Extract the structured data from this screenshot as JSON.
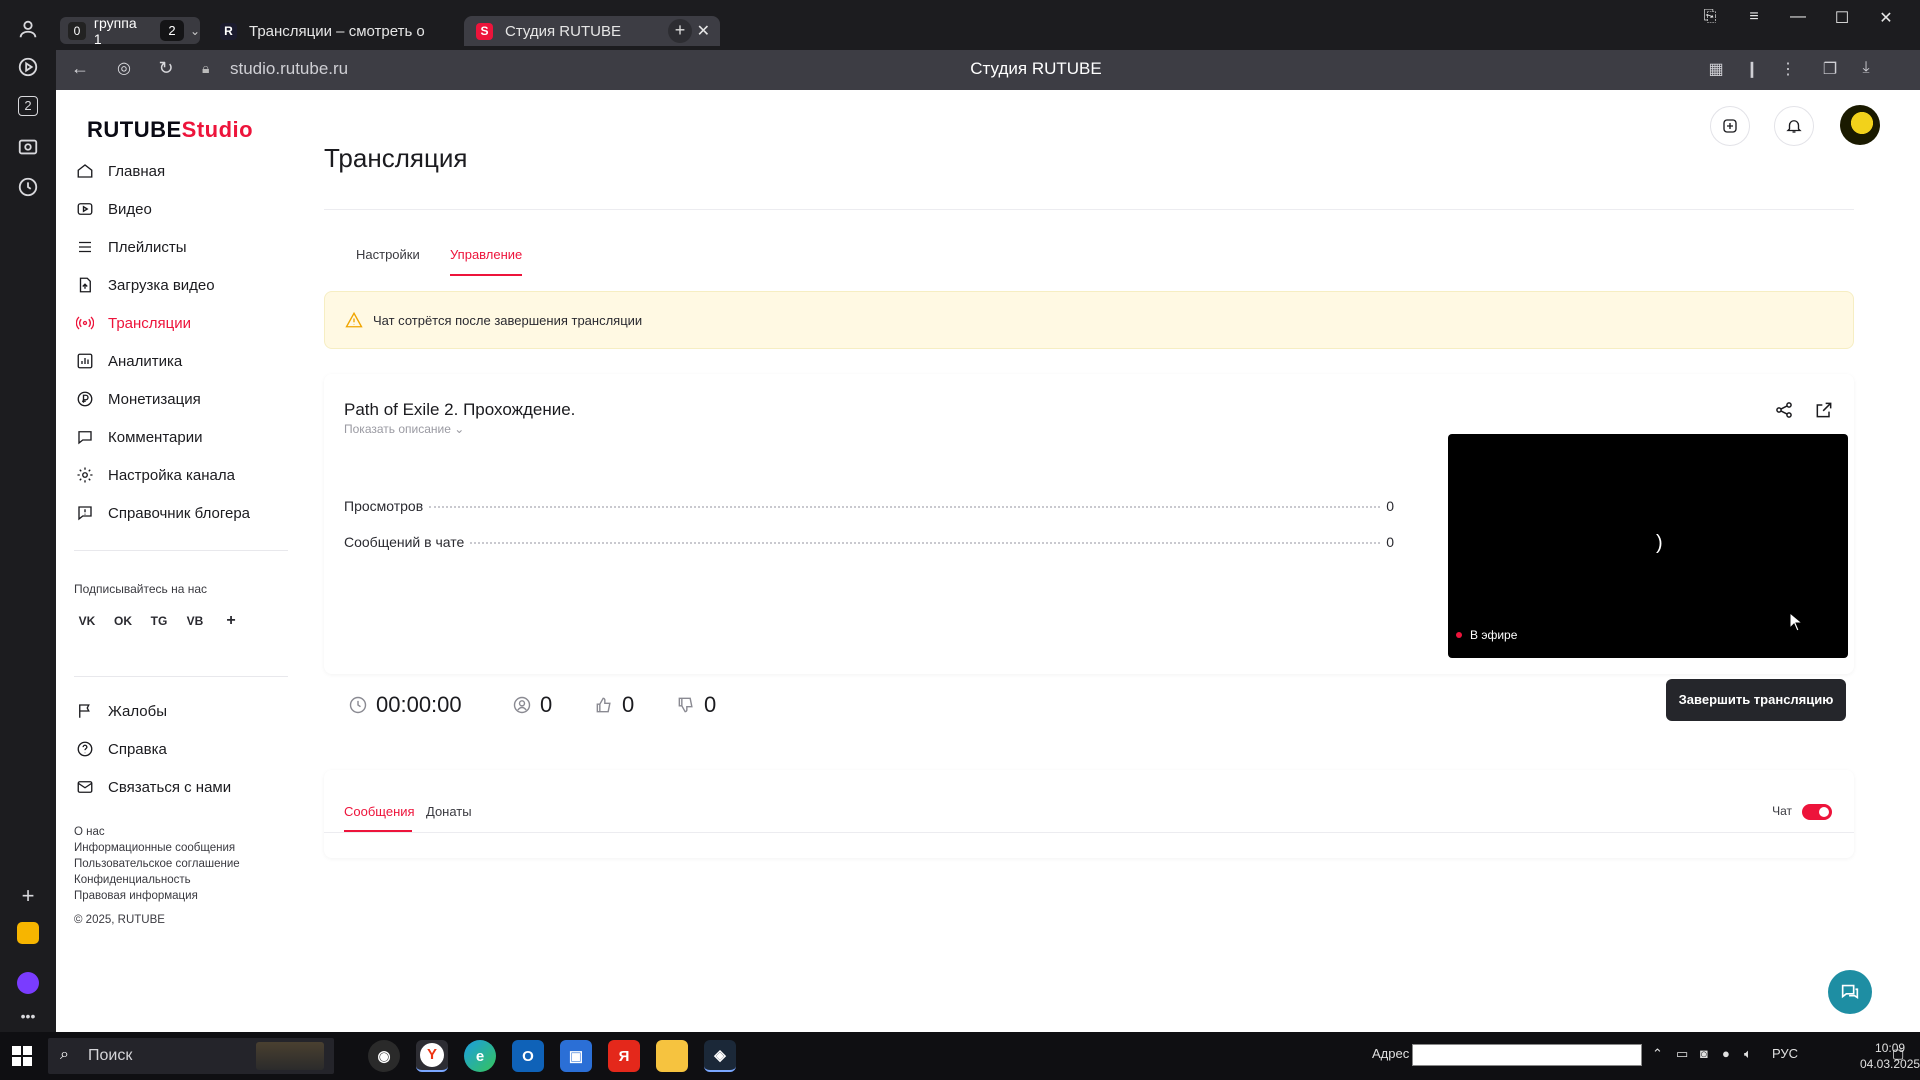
{
  "browser": {
    "group": {
      "count": "0",
      "name": "группа 1",
      "badge": "2"
    },
    "tabs": [
      {
        "label": "Трансляции – смотреть о",
        "favicon": "R"
      },
      {
        "label": "Студия RUTUBE",
        "favicon": "S"
      }
    ],
    "url": "studio.rutube.ru",
    "page_title": "Студия RUTUBE",
    "rail_badge": "2"
  },
  "logo": {
    "brand": "RUTUBE",
    "suffix": "Studio"
  },
  "sidebar": {
    "items": [
      {
        "label": "Главная",
        "icon": "home-icon"
      },
      {
        "label": "Видео",
        "icon": "video-icon"
      },
      {
        "label": "Плейлисты",
        "icon": "playlist-icon"
      },
      {
        "label": "Загрузка видео",
        "icon": "upload-icon"
      },
      {
        "label": "Трансляции",
        "icon": "broadcast-icon",
        "active": true
      },
      {
        "label": "Аналитика",
        "icon": "analytics-icon"
      },
      {
        "label": "Монетизация",
        "icon": "ruble-icon"
      },
      {
        "label": "Комментарии",
        "icon": "comments-icon"
      },
      {
        "label": "Настройка канала",
        "icon": "gear-icon"
      },
      {
        "label": "Справочник блогера",
        "icon": "book-icon"
      }
    ],
    "follow_title": "Подписывайтесь на нас",
    "socials": [
      "VK",
      "OK",
      "TG",
      "VB",
      "+"
    ],
    "secondary": [
      {
        "label": "Жалобы",
        "icon": "flag-icon"
      },
      {
        "label": "Справка",
        "icon": "help-icon"
      },
      {
        "label": "Связаться с нами",
        "icon": "mail-icon"
      }
    ],
    "footer_links": [
      "О нас",
      "Информационные сообщения",
      "Пользовательское соглашение",
      "Конфиденциальность",
      "Правовая информация"
    ],
    "copyright": "© 2025, RUTUBE"
  },
  "main": {
    "title": "Трансляция",
    "tabs": [
      "Настройки",
      "Управление"
    ],
    "active_tab": "Управление",
    "warning": "Чат сотрётся после завершения трансляции",
    "stream": {
      "title": "Path of Exile 2. Прохождение.",
      "show_description": "Показать описание",
      "stats": [
        {
          "label": "Просмотров",
          "value": "0"
        },
        {
          "label": "Сообщений в чате",
          "value": "0"
        }
      ],
      "live_badge": "В эфире",
      "duration": "00:00:00",
      "viewers": "0",
      "likes": "0",
      "dislikes": "0",
      "end_button": "Завершить трансляцию"
    },
    "chat_tabs": [
      "Сообщения",
      "Донаты"
    ],
    "chat_toggle_label": "Чат",
    "chat_enabled": true
  },
  "taskbar": {
    "search_placeholder": "Поиск",
    "address_label": "Адрес",
    "language": "РУС",
    "time": "10:09",
    "date": "04.03.2025"
  },
  "colors": {
    "accent": "#ed143b",
    "dark_button": "#25262b",
    "warning_bg": "#fff9e3"
  }
}
